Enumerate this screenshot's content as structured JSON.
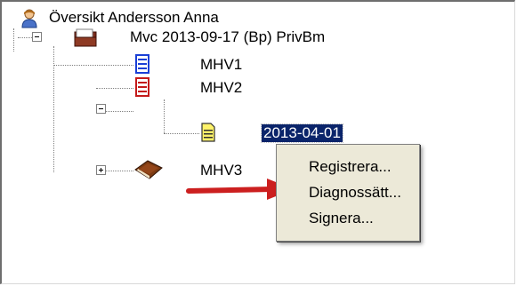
{
  "tree": {
    "root": {
      "label": "Översikt Andersson Anna",
      "icon": "person-icon"
    },
    "record": {
      "label": "Mvc 2013-09-17 (Bp)  PrivBm",
      "icon": "folder-icon",
      "expanded": true
    },
    "children": [
      {
        "label": "MHV1",
        "icon": "blue-form-icon"
      },
      {
        "label": "MHV2",
        "icon": "red-form-icon",
        "expanded": true,
        "children": [
          {
            "label": "2013-04-01",
            "icon": "yellow-document-icon",
            "selected": true
          }
        ]
      },
      {
        "label": "MHV3",
        "icon": "book-icon",
        "expanded": false
      }
    ]
  },
  "context_menu": {
    "items": [
      {
        "label": "Registrera..."
      },
      {
        "label": "Diagnossätt..."
      },
      {
        "label": "Signera..."
      }
    ]
  },
  "annotation": {
    "arrow_color": "#cc1f1f",
    "points_to": "Diagnossätt..."
  },
  "colors": {
    "selection": "#0a246a",
    "menu_bg": "#ece9d8"
  }
}
